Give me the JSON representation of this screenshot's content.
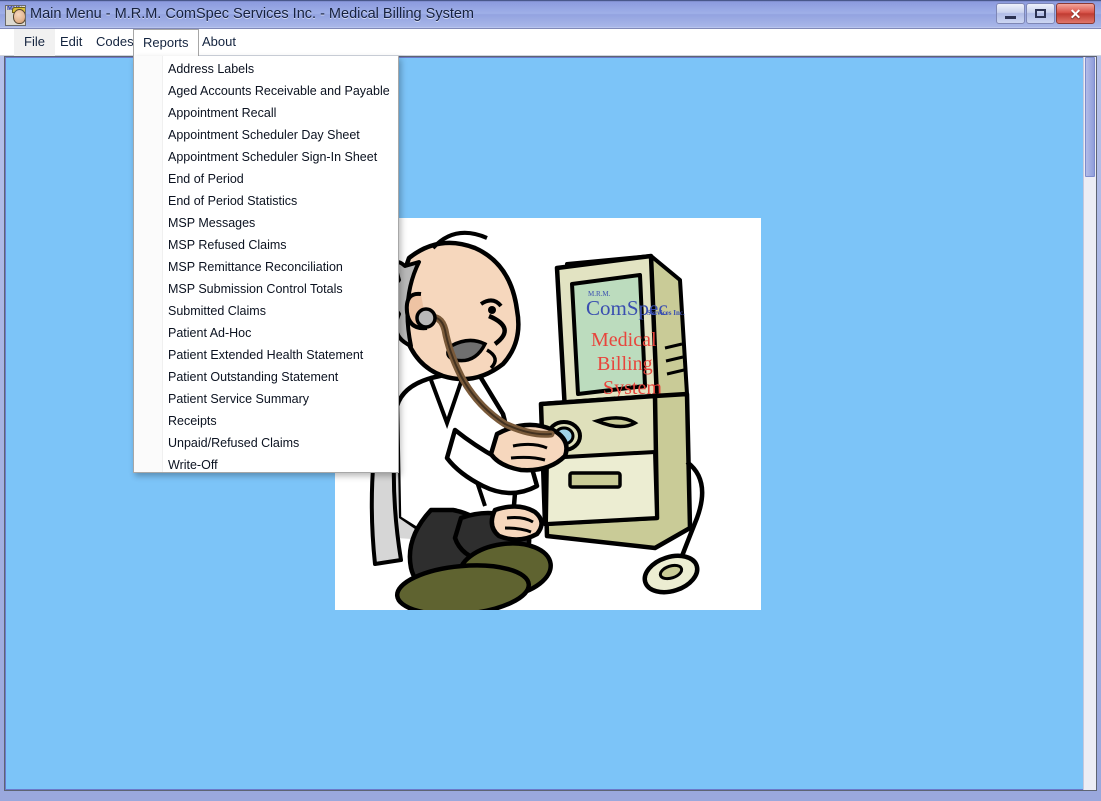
{
  "window": {
    "title": "Main Menu - M.R.M. ComSpec Services Inc. - Medical Billing System",
    "icon_name": "app-icon",
    "icon_text": "MBS",
    "buttons": {
      "minimize": "–",
      "maximize": "□",
      "close": "✕"
    },
    "titlebar_color": "#9fb0e8",
    "close_button_color": "#d9544a"
  },
  "menu_bar": {
    "items": [
      {
        "label": "File",
        "state": "hovered"
      },
      {
        "label": "Edit",
        "state": "normal"
      },
      {
        "label": "Codes",
        "state": "normal"
      },
      {
        "label": "Reports",
        "state": "open"
      },
      {
        "label": "About",
        "state": "normal"
      }
    ]
  },
  "reports_menu": {
    "open": true,
    "items": [
      "Address Labels",
      "Aged Accounts Receivable and Payable",
      "Appointment Recall",
      "Appointment Scheduler Day Sheet",
      "Appointment Scheduler Sign-In Sheet",
      "End of Period",
      "End of Period Statistics",
      "MSP Messages",
      "MSP Refused Claims",
      "MSP Remittance Reconciliation",
      "MSP Submission Control Totals",
      "Submitted Claims",
      "Patient Ad-Hoc",
      "Patient Extended Health Statement",
      "Patient Outstanding Statement",
      "Patient Service Summary",
      "Receipts",
      "Unpaid/Refused Claims",
      "Write-Off"
    ]
  },
  "client": {
    "background_color": "#7cc4f8"
  },
  "splash": {
    "alt": "Cartoon doctor with stethoscope examining a desktop computer",
    "screen": {
      "company_prefix": "M.R.M.",
      "company_name": "ComSpec",
      "company_suffix": "Services Inc.",
      "product_line_1": "Medical",
      "product_line_2": "Billing",
      "product_line_3": "System",
      "screen_color": "#bcdcbe",
      "product_text_color": "#e8453c",
      "company_text_color": "#3a4fb0"
    }
  }
}
